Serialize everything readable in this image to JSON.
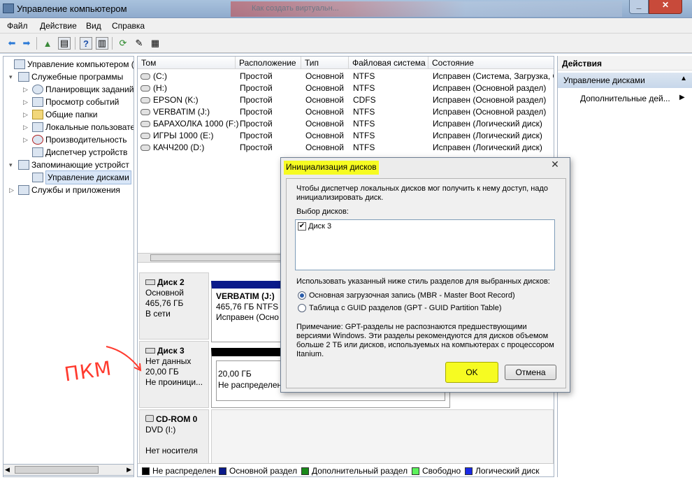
{
  "window": {
    "title": "Управление компьютером",
    "background_tab_title": "Как создать виртуальн..."
  },
  "menu": [
    "Файл",
    "Действие",
    "Вид",
    "Справка"
  ],
  "tree": {
    "items": [
      {
        "label": "Управление компьютером (л",
        "level": 0,
        "icon": "computer-icon",
        "expander": ""
      },
      {
        "label": "Служебные программы",
        "level": 1,
        "icon": "tools-icon",
        "expander": "▾"
      },
      {
        "label": "Планировщик заданий",
        "level": 2,
        "icon": "clock-icon",
        "expander": "▷"
      },
      {
        "label": "Просмотр событий",
        "level": 2,
        "icon": "event-viewer-icon",
        "expander": "▷"
      },
      {
        "label": "Общие папки",
        "level": 2,
        "icon": "folder-icon",
        "expander": "▷"
      },
      {
        "label": "Локальные пользовате",
        "level": 2,
        "icon": "users-icon",
        "expander": "▷"
      },
      {
        "label": "Производительность",
        "level": 2,
        "icon": "performance-icon",
        "expander": "▷"
      },
      {
        "label": "Диспетчер устройств",
        "level": 2,
        "icon": "device-manager-icon",
        "expander": ""
      },
      {
        "label": "Запоминающие устройст",
        "level": 1,
        "icon": "storage-icon",
        "expander": "▾"
      },
      {
        "label": "Управление дисками",
        "level": 2,
        "icon": "disk-management-icon",
        "expander": "",
        "selected": true
      },
      {
        "label": "Службы и приложения",
        "level": 1,
        "icon": "services-icon",
        "expander": "▷"
      }
    ]
  },
  "volumes": {
    "columns": [
      "Том",
      "Расположение",
      "Тип",
      "Файловая система",
      "Состояние"
    ],
    "rows": [
      [
        "(C:)",
        "Простой",
        "Основной",
        "NTFS",
        "Исправен (Система, Загрузка, С"
      ],
      [
        "(H:)",
        "Простой",
        "Основной",
        "NTFS",
        "Исправен (Основной раздел)"
      ],
      [
        "EPSON (K:)",
        "Простой",
        "Основной",
        "CDFS",
        "Исправен (Основной раздел)"
      ],
      [
        "VERBATIM (J:)",
        "Простой",
        "Основной",
        "NTFS",
        "Исправен (Основной раздел)"
      ],
      [
        "БАРАХОЛКА 1000 (F:)",
        "Простой",
        "Основной",
        "NTFS",
        "Исправен (Логический диск)"
      ],
      [
        "ИГРЫ 1000 (E:)",
        "Простой",
        "Основной",
        "NTFS",
        "Исправен (Логический диск)"
      ],
      [
        "КАЧЧ200 (D:)",
        "Простой",
        "Основной",
        "NTFS",
        "Исправен (Логический диск)"
      ]
    ]
  },
  "disks": [
    {
      "name": "Диск 2",
      "lines": [
        "Основной",
        "465,76 ГБ",
        "В сети"
      ],
      "partition": {
        "title": "VERBATIM  (J:)",
        "lines": [
          "465,76 ГБ NTFS",
          "Исправен (Осно"
        ]
      },
      "bar_color": "#0a1a8a"
    },
    {
      "name": "Диск 3",
      "lines": [
        "Нет данных",
        "20,00 ГБ",
        "Не проиници..."
      ],
      "partition": {
        "title": "",
        "lines": [
          "20,00 ГБ",
          "Не распределен"
        ]
      },
      "bar_color": "#000000"
    },
    {
      "name": "CD-ROM 0",
      "lines": [
        "DVD (I:)",
        "",
        "Нет носителя"
      ]
    }
  ],
  "legend": [
    {
      "label": "Не распределен",
      "color": "#000000"
    },
    {
      "label": "Основной раздел",
      "color": "#0a1a8a"
    },
    {
      "label": "Дополнительный раздел",
      "color": "#1a8a1a"
    },
    {
      "label": "Свободно",
      "color": "#5cf25c"
    },
    {
      "label": "Логический диск",
      "color": "#1a2ae6"
    }
  ],
  "actions": {
    "header": "Действия",
    "group": "Управление дисками",
    "item": "Дополнительные дей..."
  },
  "dialog": {
    "title": "Инициализация дисков",
    "intro": "Чтобы диспетчер локальных дисков мог получить к нему доступ, надо инициализировать диск.",
    "select_label": "Выбор дисков:",
    "disk_item": "Диск 3",
    "style_label": "Использовать указанный ниже стиль разделов для выбранных дисков:",
    "option_mbr": "Основная загрузочная запись (MBR - Master Boot Record)",
    "option_gpt": "Таблица с GUID разделов (GPT - GUID Partition Table)",
    "note": "Примечание: GPT-разделы не распознаются предшествующими версиями Windows. Эти разделы рекомендуются для дисков объемом больше 2 ТБ или дисков, используемых на компьютерах с процессором Itanium.",
    "ok": "OK",
    "cancel": "Отмена"
  },
  "annotation": "ПКМ",
  "colors": {
    "highlight": "#f6fb22",
    "annotation": "#ff3b2f",
    "selection": "#d9e6f7"
  }
}
